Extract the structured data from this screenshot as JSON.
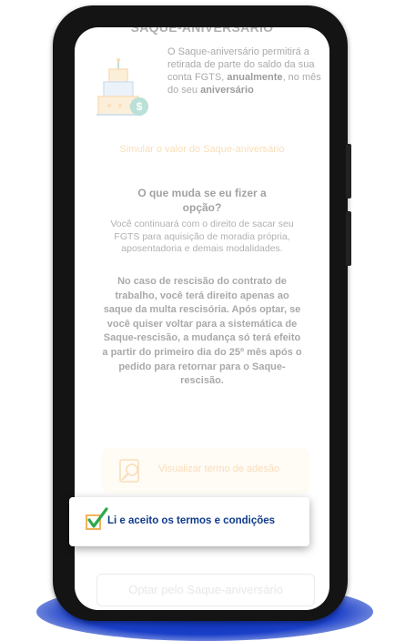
{
  "screen": {
    "section_title": "SAQUE-ANIVERSÁRIO",
    "intro": {
      "part1": "O Saque-aniversário permitirá a retirada de parte do saldo da sua conta FGTS, ",
      "bold1": "anualmente",
      "part2": ", no mês do seu ",
      "bold2": "aniversário"
    },
    "simulate_link": "Simular o valor do Saque-aniversário",
    "question": "O que muda se eu fizer a opção?",
    "body_text": "Você continuará com o direito de sacar seu FGTS para aquisição de moradia própria, aposentadoria e demais modalidades.",
    "body_bold": "No caso de rescisão do contrato de trabalho, você terá direito apenas ao saque da multa rescisória. Após optar, se você quiser voltar para a sistemática de Saque-rescisão, a mudança só terá efeito a partir do primeiro dia do 25º mês após o pedido para retornar para o Saque-rescisão.",
    "terms_button": "Visualizar termo de adesão",
    "opt_button": "Optar pelo Saque-aniversário"
  },
  "accept": {
    "label": "Li e aceito os termos e condições",
    "checked": true
  },
  "icons": {
    "cake": "birthday-cake-icon",
    "coin": "dollar-coin-icon",
    "search_doc": "search-document-icon",
    "checkbox": "checkmark-checkbox-icon"
  },
  "colors": {
    "accent_orange": "#f2b35b",
    "brand_blue": "#0f3b8c",
    "check_green": "#2ea84a",
    "cake_blue": "#9bb9d8",
    "coin_teal": "#5cb5a3",
    "phone_shadow": "#1a3fc8"
  }
}
